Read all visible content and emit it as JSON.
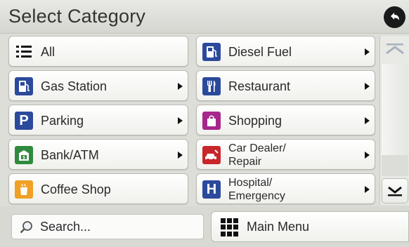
{
  "header": {
    "title": "Select Category"
  },
  "categories": [
    {
      "label": "All",
      "icon": "list-icon",
      "color": "#ffffff",
      "has_arrow": false
    },
    {
      "label": "Diesel Fuel",
      "icon": "fuel-pump-icon",
      "color": "#2b4a9c",
      "has_arrow": true
    },
    {
      "label": "Gas Station",
      "icon": "fuel-pump-icon",
      "color": "#2b4a9c",
      "has_arrow": true
    },
    {
      "label": "Restaurant",
      "icon": "fork-knife-icon",
      "color": "#2b4a9c",
      "has_arrow": true
    },
    {
      "label": "Parking",
      "icon": "parking-icon",
      "color": "#2b4a9c",
      "has_arrow": true
    },
    {
      "label": "Shopping",
      "icon": "shopping-bag-icon",
      "color": "#a6268c",
      "has_arrow": true
    },
    {
      "label": "Bank/ATM",
      "icon": "bank-icon",
      "color": "#2f8a3e",
      "has_arrow": true
    },
    {
      "label": "Car Dealer/\nRepair",
      "icon": "car-repair-icon",
      "color": "#c8262a",
      "has_arrow": true
    },
    {
      "label": "Coffee Shop",
      "icon": "coffee-cup-icon",
      "color": "#f0a024",
      "has_arrow": false
    },
    {
      "label": "Hospital/\nEmergency",
      "icon": "hospital-icon",
      "color": "#2b4a9c",
      "has_arrow": true
    }
  ],
  "search": {
    "label": "Search..."
  },
  "footer": {
    "main_menu_label": "Main Menu"
  }
}
